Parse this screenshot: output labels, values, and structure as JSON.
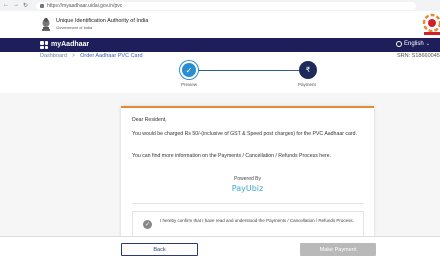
{
  "browser": {
    "url": "https://myaadhaar.uidai.gov.in/pvc"
  },
  "header": {
    "org_name": "Unique Identification Authority of India",
    "org_sub": "Government of India"
  },
  "nav": {
    "brand": "myAadhaar",
    "language": "English",
    "bg_color": "#1e1e5a"
  },
  "breadcrumb": {
    "home": "Dashboard",
    "separator": ">",
    "current": "Order Aadhaar PVC Card"
  },
  "srn": "SRN: S18660045",
  "stepper": {
    "step1_label": "Preview",
    "step2_label": "Payment",
    "step1_glyph": "✓",
    "step2_glyph": "₹"
  },
  "card": {
    "greeting": "Dear Resident,",
    "charge_text": "You would be charged Rs 50/-(inclusive of GST & Speed post charges) for the PVC Aadhaar card.",
    "info_text": "You can find more information on the Payments / Cancellation / Refunds Process here.",
    "powered_by": "Powered By",
    "gateway": "PayUbiz",
    "confirm_text": "I hereby confirm that I have read and understood the Payments / Cancellation / Refunds Process."
  },
  "footer": {
    "back_label": "Back",
    "pay_label": "Make Payment"
  }
}
